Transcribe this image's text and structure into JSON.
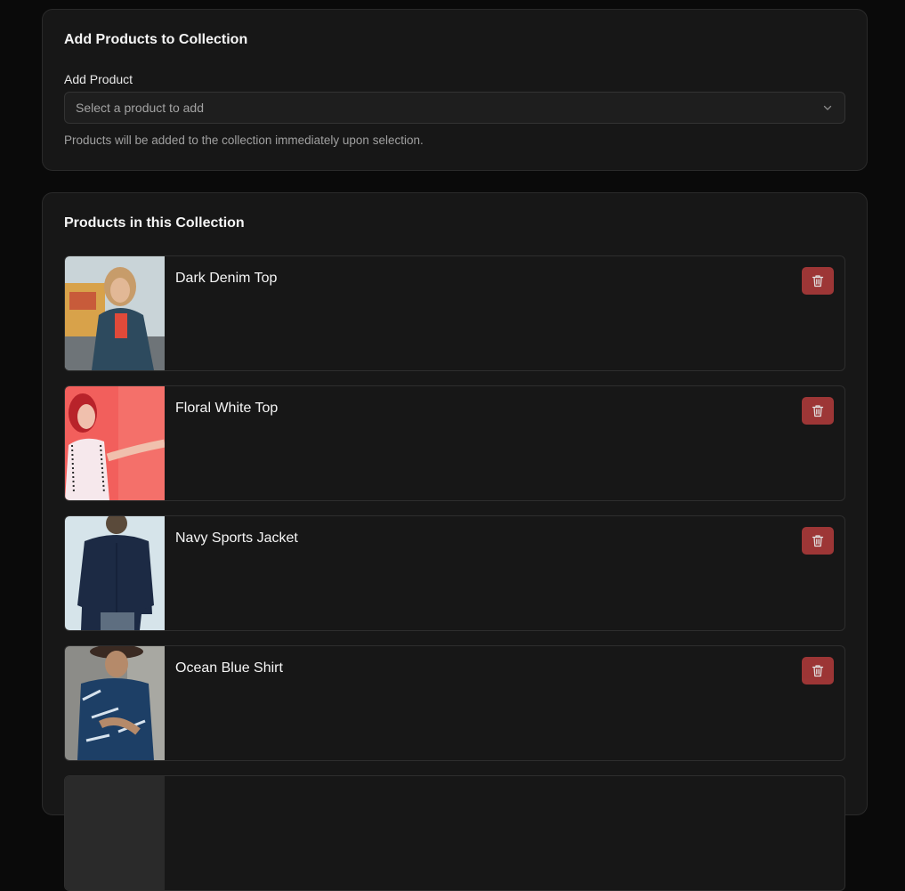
{
  "add_section": {
    "title": "Add Products to Collection",
    "field_label": "Add Product",
    "select_placeholder": "Select a product to add",
    "help_text": "Products will be added to the collection immediately upon selection."
  },
  "products_section": {
    "title": "Products in this Collection",
    "items": [
      {
        "name": "Dark Denim Top"
      },
      {
        "name": "Floral White Top"
      },
      {
        "name": "Navy Sports Jacket"
      },
      {
        "name": "Ocean Blue Shirt"
      }
    ]
  },
  "colors": {
    "background": "#0a0a0a",
    "card": "#171717",
    "delete_button": "#b03b3b"
  },
  "icons": {
    "select_chevron": "chevron-down-icon",
    "delete": "trash-icon"
  }
}
